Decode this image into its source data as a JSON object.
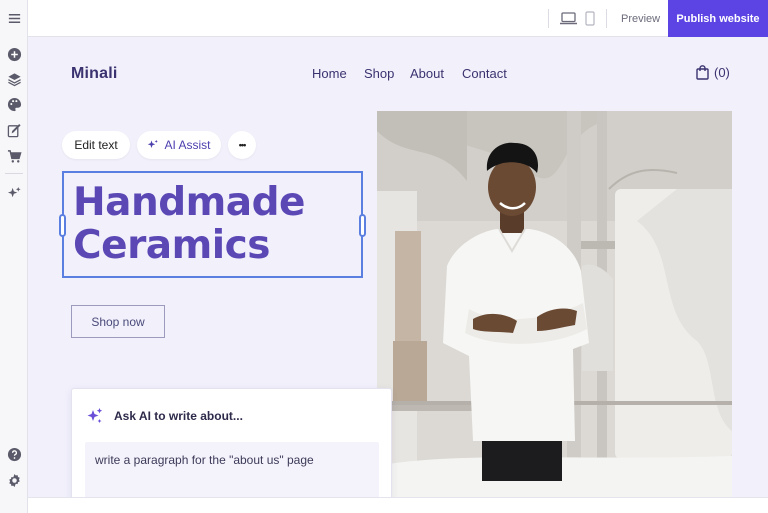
{
  "toolbar": {
    "icons": [
      "menu-icon",
      "add-circle-icon",
      "layers-icon",
      "palette-icon",
      "edit-page-icon",
      "cart-icon",
      "ai-sparkle-icon",
      "help-icon",
      "settings-icon"
    ]
  },
  "topbar": {
    "preview_label": "Preview",
    "publish_label": "Publish website",
    "accent_color": "#5c44e4"
  },
  "site": {
    "logo": "Minali",
    "nav": [
      "Home",
      "Shop",
      "About",
      "Contact"
    ],
    "cart_count": "(0)"
  },
  "editor": {
    "edit_text_label": "Edit text",
    "ai_assist_label": "AI Assist",
    "more_label": "•••"
  },
  "hero": {
    "headline_line1": "Handmade",
    "headline_line2": "Ceramics",
    "cta_label": "Shop now"
  },
  "ai_panel": {
    "title": "Ask AI to write about...",
    "prompt_value": "write a paragraph for the \"about us\" page"
  }
}
